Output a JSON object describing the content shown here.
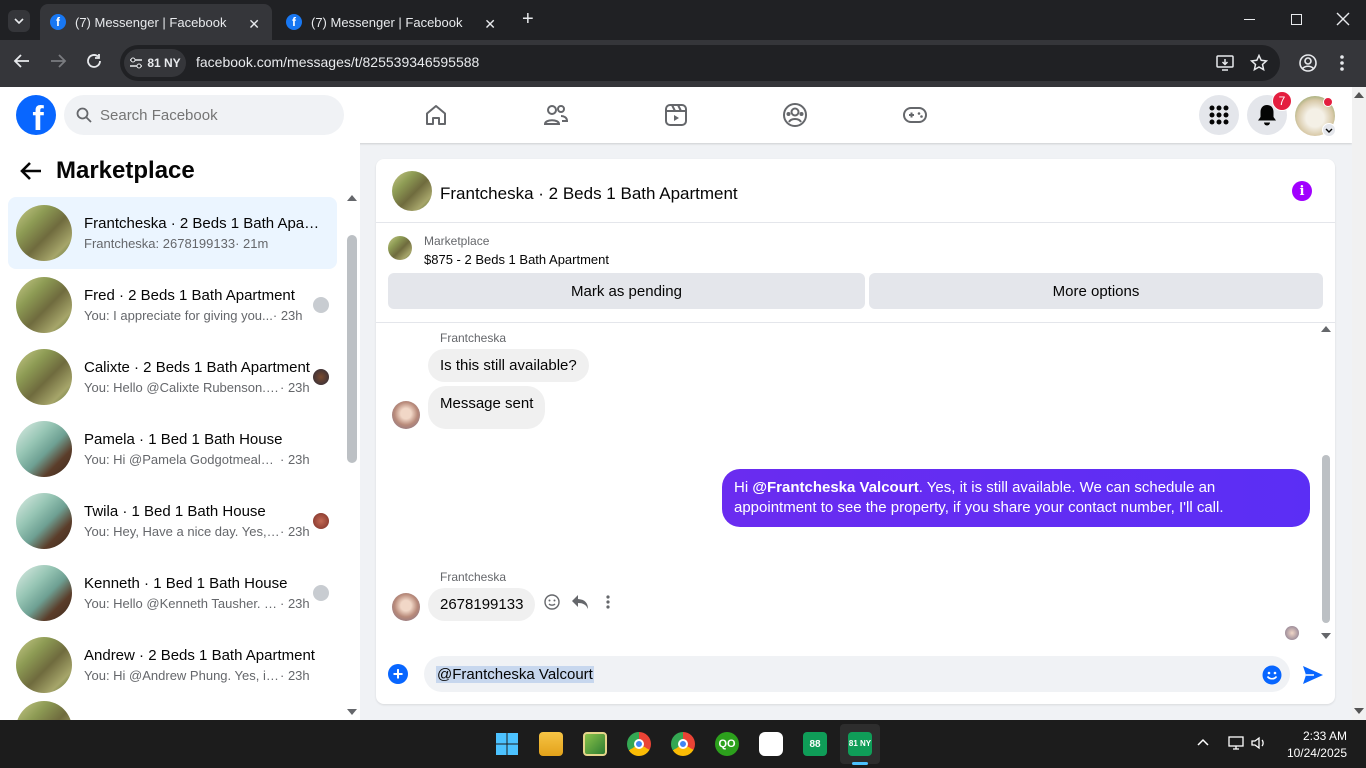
{
  "browser": {
    "tabs": [
      {
        "title": "(7) Messenger | Facebook",
        "close": "✕"
      },
      {
        "title": "(7) Messenger | Facebook",
        "close": "✕"
      }
    ],
    "new_tab": "+",
    "site_chip": "81 NY",
    "url": "facebook.com/messages/t/825539346595588"
  },
  "header": {
    "search_placeholder": "Search Facebook",
    "notifications_count": "7"
  },
  "sidebar": {
    "title": "Marketplace",
    "conversations": [
      {
        "name": "Frantcheska · 2 Beds 1 Bath Apartment",
        "snippet": "Frantcheska: 2678199133",
        "time": "· 21m",
        "active": true,
        "thumb": "ext"
      },
      {
        "name": "Fred · 2 Beds 1 Bath Apartment",
        "snippet": "You: I appreciate for giving you...",
        "time": "· 23h",
        "thumb": "ext"
      },
      {
        "name": "Calixte · 2 Beds 1 Bath Apartment",
        "snippet": "You: Hello @Calixte Rubenson. ...",
        "time": "· 23h",
        "thumb": "ext"
      },
      {
        "name": "Pamela · 1 Bed 1 Bath House",
        "snippet": "You: Hi @Pamela Godgotmealway...",
        "time": "· 23h",
        "thumb": "int"
      },
      {
        "name": "Twila · 1 Bed 1 Bath House",
        "snippet": "You: Hey, Have a nice day. Yes, ...",
        "time": "· 23h",
        "thumb": "int"
      },
      {
        "name": "Kenneth · 1 Bed 1 Bath House",
        "snippet": "You: Hello @Kenneth Tausher. Y...",
        "time": "· 23h",
        "thumb": "int"
      },
      {
        "name": "Andrew · 2 Beds 1 Bath Apartment",
        "snippet": "You: Hi @Andrew Phung. Yes, it is ...",
        "time": "· 23h",
        "thumb": "ext"
      }
    ]
  },
  "chat": {
    "title": "Frantcheska · 2 Beds 1 Bath Apartment",
    "listing_source": "Marketplace",
    "listing_title": "$875 - 2 Beds 1 Bath Apartment",
    "mark_pending_label": "Mark as pending",
    "more_options_label": "More options",
    "messages": {
      "sender_1": "Frantcheska",
      "in_1": "Is this still available?",
      "in_2": "Message sent",
      "out_mention": "@Frantcheska Valcourt",
      "out_pre": "Hi ",
      "out_post": ". Yes, it is still available. We can schedule an appointment to see the property, if you share your contact number, I'll call.",
      "sender_2": "Frantcheska",
      "in_3": "2678199133"
    },
    "composer_text": "@Frantcheska Valcourt"
  },
  "taskbar": {
    "time": "2:33 AM",
    "date": "10/24/2025",
    "app_88": "88",
    "app_81": "81 NY"
  },
  "colors": {
    "fb_blue": "#0866ff",
    "outgoing_bubble": "#5b2ef5",
    "active_conv": "#ebf5ff",
    "info_purple": "#a100ff"
  }
}
